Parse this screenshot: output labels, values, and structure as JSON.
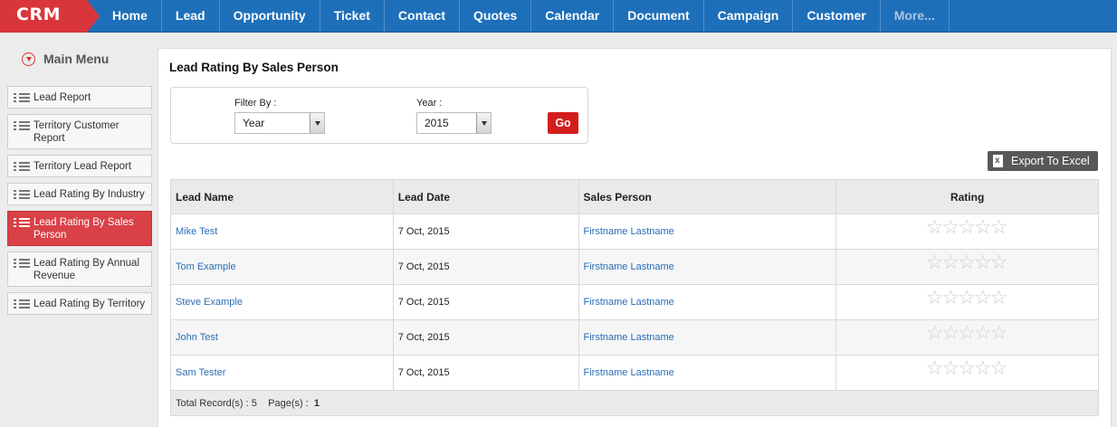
{
  "brand": "CRM",
  "nav": [
    "Home",
    "Lead",
    "Opportunity",
    "Ticket",
    "Contact",
    "Quotes",
    "Calendar",
    "Document",
    "Campaign",
    "Customer",
    "More..."
  ],
  "sidebar": {
    "title": "Main Menu",
    "items": [
      {
        "label": "Lead Report",
        "active": false
      },
      {
        "label": "Territory Customer Report",
        "active": false
      },
      {
        "label": "Territory Lead Report",
        "active": false
      },
      {
        "label": "Lead Rating By Industry",
        "active": false
      },
      {
        "label": "Lead Rating By Sales Person",
        "active": true
      },
      {
        "label": "Lead Rating By Annual Revenue",
        "active": false
      },
      {
        "label": "Lead Rating By Territory",
        "active": false
      }
    ]
  },
  "page": {
    "title": "Lead Rating By Sales Person"
  },
  "filter": {
    "filter_by_label": "Filter By :",
    "filter_by_value": "Year",
    "year_label": "Year :",
    "year_value": "2015",
    "go_label": "Go"
  },
  "export_label": "Export To Excel",
  "table": {
    "headers": [
      "Lead Name",
      "Lead Date",
      "Sales Person",
      "Rating"
    ],
    "rows": [
      {
        "lead_name": "Mike Test",
        "lead_date": "7 Oct, 2015",
        "sales_person": "Firstname Lastname",
        "rating": 0
      },
      {
        "lead_name": "Tom Example",
        "lead_date": "7 Oct, 2015",
        "sales_person": "Firstname Lastname",
        "rating": 0
      },
      {
        "lead_name": "Steve Example",
        "lead_date": "7 Oct, 2015",
        "sales_person": "Firstname Lastname",
        "rating": 0
      },
      {
        "lead_name": "John Test",
        "lead_date": "7 Oct, 2015",
        "sales_person": "Firstname Lastname",
        "rating": 0
      },
      {
        "lead_name": "Sam Tester",
        "lead_date": "7 Oct, 2015",
        "sales_person": "Firstname Lastname",
        "rating": 0
      }
    ],
    "rating_max": 5,
    "footer": {
      "records_label": "Total Record(s) :",
      "records_value": "5",
      "pages_label": "Page(s) :",
      "pages_value": "1"
    }
  },
  "colors": {
    "nav_bg": "#1e6fb9",
    "brand_bg": "#d9363b",
    "active_item": "#d94147",
    "go_button": "#d41d1d",
    "link": "#2a6db5"
  }
}
